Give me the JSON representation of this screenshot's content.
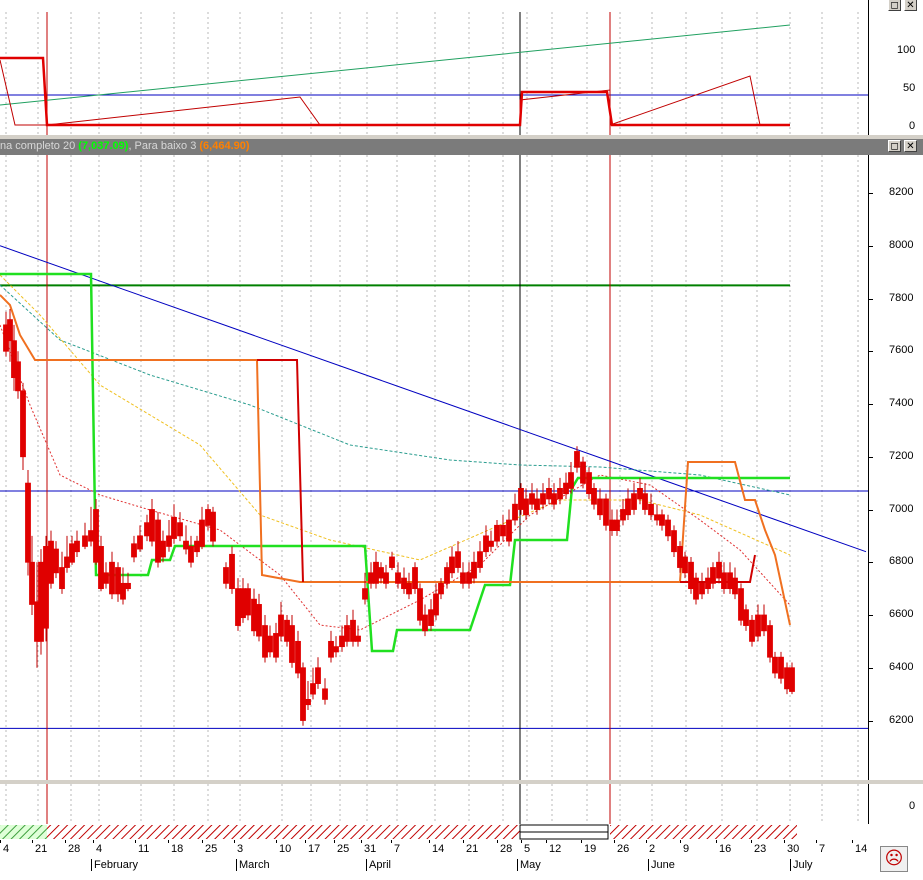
{
  "top_panel": {
    "y_ticks": [
      "100",
      "50",
      "0"
    ],
    "close_icon": "close-icon",
    "max_icon": "maximize-icon"
  },
  "main_title": {
    "prefix": "na completo 20",
    "value1": "(7,037.09)",
    "sep": ", Para baixo 3",
    "value2": "(6,464.90)",
    "value1_color": "#00ff00",
    "value2_color": "#ff8000"
  },
  "bottom_panel": {
    "y_tick": "0"
  },
  "x_axis": {
    "day_ticks": [
      "4",
      "21",
      "28",
      "4",
      "11",
      "18",
      "25",
      "3",
      "10",
      "17",
      "25",
      "31",
      "7",
      "14",
      "21",
      "28",
      "5",
      "12",
      "19",
      "26",
      "2",
      "9",
      "16",
      "23",
      "30",
      "7",
      "14"
    ],
    "months": [
      "February",
      "March",
      "April",
      "May",
      "June",
      "July"
    ]
  },
  "colors": {
    "up": "#ffffff",
    "down": "#e00000",
    "green": "#00c000",
    "orange": "#ff7000",
    "trend": "#0000c0",
    "hline": "#0000c0"
  },
  "chart_data": {
    "type": "candlestick",
    "title": "",
    "y_ticks": [
      6200,
      6400,
      6600,
      6800,
      7000,
      7200,
      7400,
      7600,
      7800,
      8000,
      8200
    ],
    "ylim": [
      6150,
      8270
    ],
    "horizontal_lines": [
      7850,
      7070,
      6170
    ],
    "trendline": {
      "start": 8000,
      "end_x": "June 30",
      "end": 6840
    },
    "indicator_lines": [
      "completo 20 (7,037.09)",
      "Para baixo 3 (6,464.90)"
    ],
    "grid": true
  }
}
